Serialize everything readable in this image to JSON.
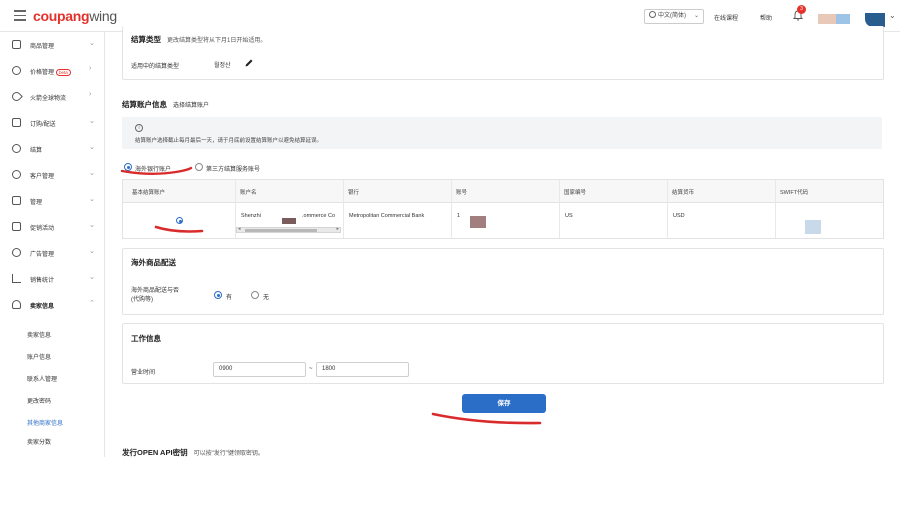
{
  "header": {
    "logo_part1": "coupang",
    "logo_part2": "wing",
    "language": "中文(简体)",
    "link_online_course": "在线课程",
    "link_help": "帮助",
    "notification_count": "3"
  },
  "sidebar": {
    "items": [
      {
        "label": "商品管理",
        "icon": "box-icon"
      },
      {
        "label": "价格管理",
        "icon": "price-tag-icon",
        "badge": "beta"
      },
      {
        "label": "火箭全球物流",
        "icon": "rocket-icon"
      },
      {
        "label": "订购/配送",
        "icon": "order-icon"
      },
      {
        "label": "结算",
        "icon": "settlement-icon"
      },
      {
        "label": "客户管理",
        "icon": "customer-icon"
      },
      {
        "label": "管理",
        "icon": "manage-icon"
      },
      {
        "label": "促销活动",
        "icon": "promotion-icon"
      },
      {
        "label": "广告管理",
        "icon": "ads-icon"
      },
      {
        "label": "销售统计",
        "icon": "chart-icon"
      },
      {
        "label": "卖家信息",
        "icon": "user-icon"
      }
    ],
    "sub_items": [
      "卖家信息",
      "账户信息",
      "联系人管理",
      "更改密码",
      "其他商家信息",
      "卖家分数"
    ]
  },
  "settlement_type": {
    "title": "结算类型",
    "note": "更改结算类型将从下月1日开始适用。",
    "label": "适用中的结算类型",
    "value": "월정산"
  },
  "account_info": {
    "title": "结算账户信息",
    "link": "选择结算账户",
    "info_text": "结算账户选择截止每月最后一天，请于月底前设置结算账户以避免结算延误。",
    "radio_overseas": "海外银行账户",
    "radio_thirdparty": "第三方结算服务账号",
    "table": {
      "headers": [
        "基本结算账户",
        "账户名",
        "银行",
        "账号",
        "国家编号",
        "结算货币",
        "SWIFT代码"
      ],
      "row": {
        "account_name_start": "Shenzhi",
        "account_name_end": ".ommerce Co",
        "bank": "Metropolitan Commercial Bank",
        "account_number_prefix": "1",
        "country": "US",
        "currency": "USD"
      }
    }
  },
  "overseas_delivery": {
    "title": "海外商品配送",
    "question": "海外商品配送与否\n(代购等)",
    "yes": "有",
    "no": "无"
  },
  "work_info": {
    "title": "工作信息",
    "label": "营业时间",
    "start": "0900",
    "separator": "~",
    "end": "1800"
  },
  "save_label": "保存",
  "api_section": {
    "title": "发行OPEN API密钥",
    "note": "可以按\"发行\"键领取密钥。"
  },
  "colors": {
    "brand_red": "#e4312b",
    "primary_blue": "#2b6ec8",
    "annotation_red": "#d92b2b"
  }
}
